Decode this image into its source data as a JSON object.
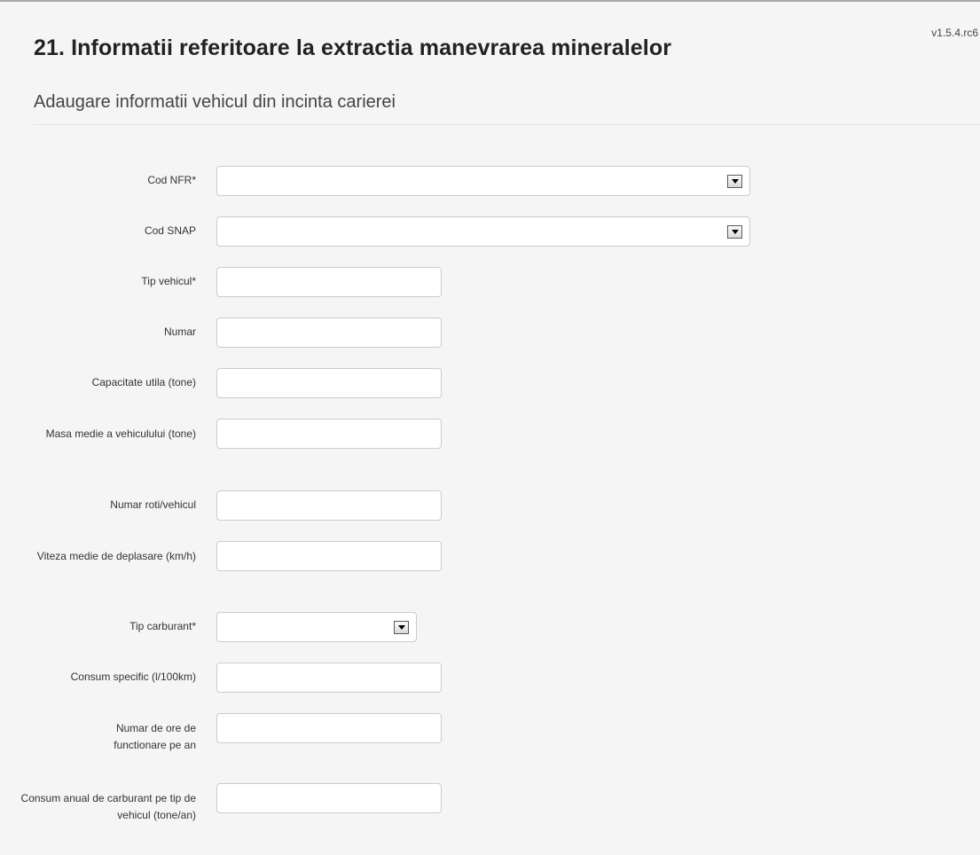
{
  "header": {
    "version": "v1.5.4.rc6",
    "title": "21. Informatii referitoare la extractia manevrarea mineralelor",
    "subtitle": "Adaugare informatii vehicul din incinta carierei"
  },
  "form": {
    "cod_nfr": {
      "label": "Cod NFR*",
      "value": ""
    },
    "cod_snap": {
      "label": "Cod SNAP",
      "value": ""
    },
    "tip_vehicul": {
      "label": "Tip vehicul*",
      "value": ""
    },
    "numar": {
      "label": "Numar",
      "value": ""
    },
    "capacitate_utila": {
      "label": "Capacitate utila (tone)",
      "value": ""
    },
    "masa_medie": {
      "label": "Masa medie a vehiculului (tone)",
      "value": ""
    },
    "numar_roti": {
      "label": "Numar roti/vehicul",
      "value": ""
    },
    "viteza_medie": {
      "label": "Viteza medie de deplasare (km/h)",
      "value": ""
    },
    "tip_carburant": {
      "label": "Tip carburant*",
      "value": ""
    },
    "consum_specific": {
      "label": "Consum specific (l/100km)",
      "value": ""
    },
    "ore_functionare": {
      "label": "Numar de ore de functionare pe an",
      "value": ""
    },
    "consum_anual": {
      "label": "Consum anual de carburant pe tip de vehicul (tone/an)",
      "value": ""
    }
  },
  "icons": {
    "dropdown": "dropdown-arrow-icon"
  }
}
